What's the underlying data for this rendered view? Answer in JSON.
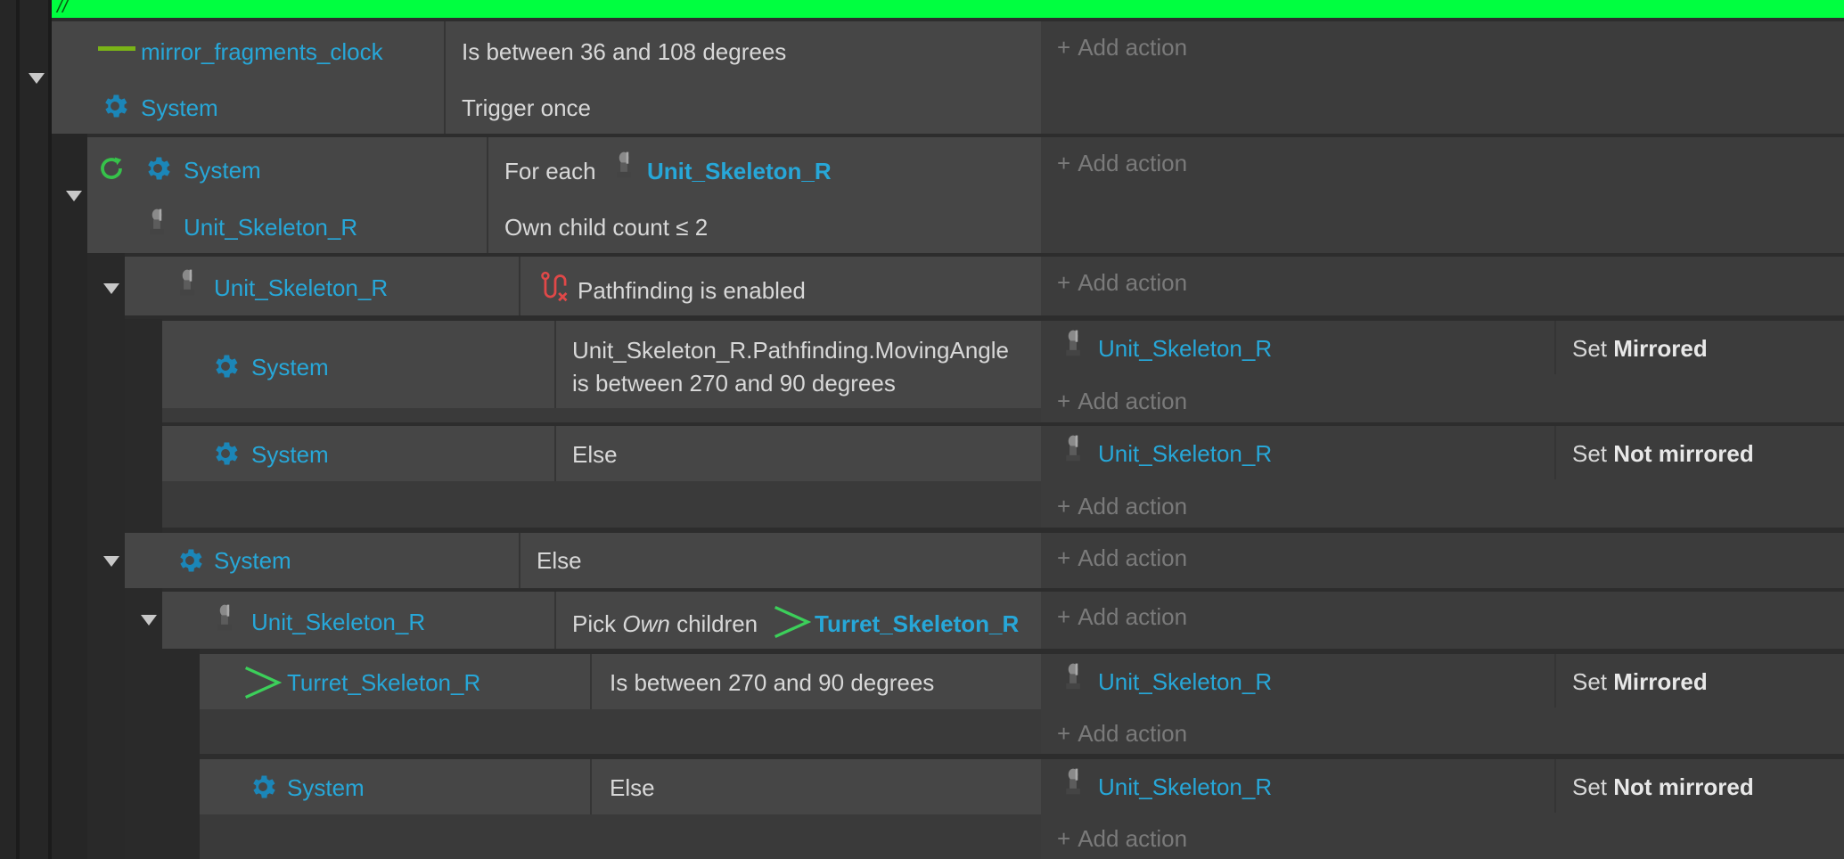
{
  "comment": {
    "text": "//"
  },
  "add_action": "Add action",
  "event1": {
    "cond1": {
      "object": "mirror_fragments_clock",
      "text": "Is between 36 and 108 degrees"
    },
    "cond2": {
      "object": "System",
      "text": "Trigger once"
    }
  },
  "event2": {
    "cond1": {
      "object": "System",
      "text_prefix": "For each",
      "param": "Unit_Skeleton_R"
    },
    "cond2": {
      "object": "Unit_Skeleton_R",
      "text": "Own child count ≤ 2"
    }
  },
  "event3": {
    "cond1": {
      "object": "Unit_Skeleton_R",
      "text": "Pathfinding is enabled"
    }
  },
  "event4": {
    "cond1": {
      "object": "System",
      "text_line1": "Unit_Skeleton_R.Pathfinding.MovingAngle",
      "text_line2": "is between 270 and 90 degrees"
    },
    "action1": {
      "object": "Unit_Skeleton_R",
      "verb": "Set",
      "value": "Mirrored"
    }
  },
  "event5": {
    "cond1": {
      "object": "System",
      "text": "Else"
    },
    "action1": {
      "object": "Unit_Skeleton_R",
      "verb": "Set",
      "value": "Not mirrored"
    }
  },
  "event6": {
    "cond1": {
      "object": "System",
      "text": "Else"
    }
  },
  "event7": {
    "cond1": {
      "object": "Unit_Skeleton_R",
      "text_prefix": "Pick",
      "text_italic": "Own",
      "text_mid": "children",
      "param": "Turret_Skeleton_R"
    }
  },
  "event8": {
    "cond1": {
      "object": "Turret_Skeleton_R",
      "text": "Is between 270 and 90 degrees"
    },
    "action1": {
      "object": "Unit_Skeleton_R",
      "verb": "Set",
      "value": "Mirrored"
    }
  },
  "event9": {
    "cond1": {
      "object": "System",
      "text": "Else"
    },
    "action1": {
      "object": "Unit_Skeleton_R",
      "verb": "Set",
      "value": "Not mirrored"
    }
  }
}
